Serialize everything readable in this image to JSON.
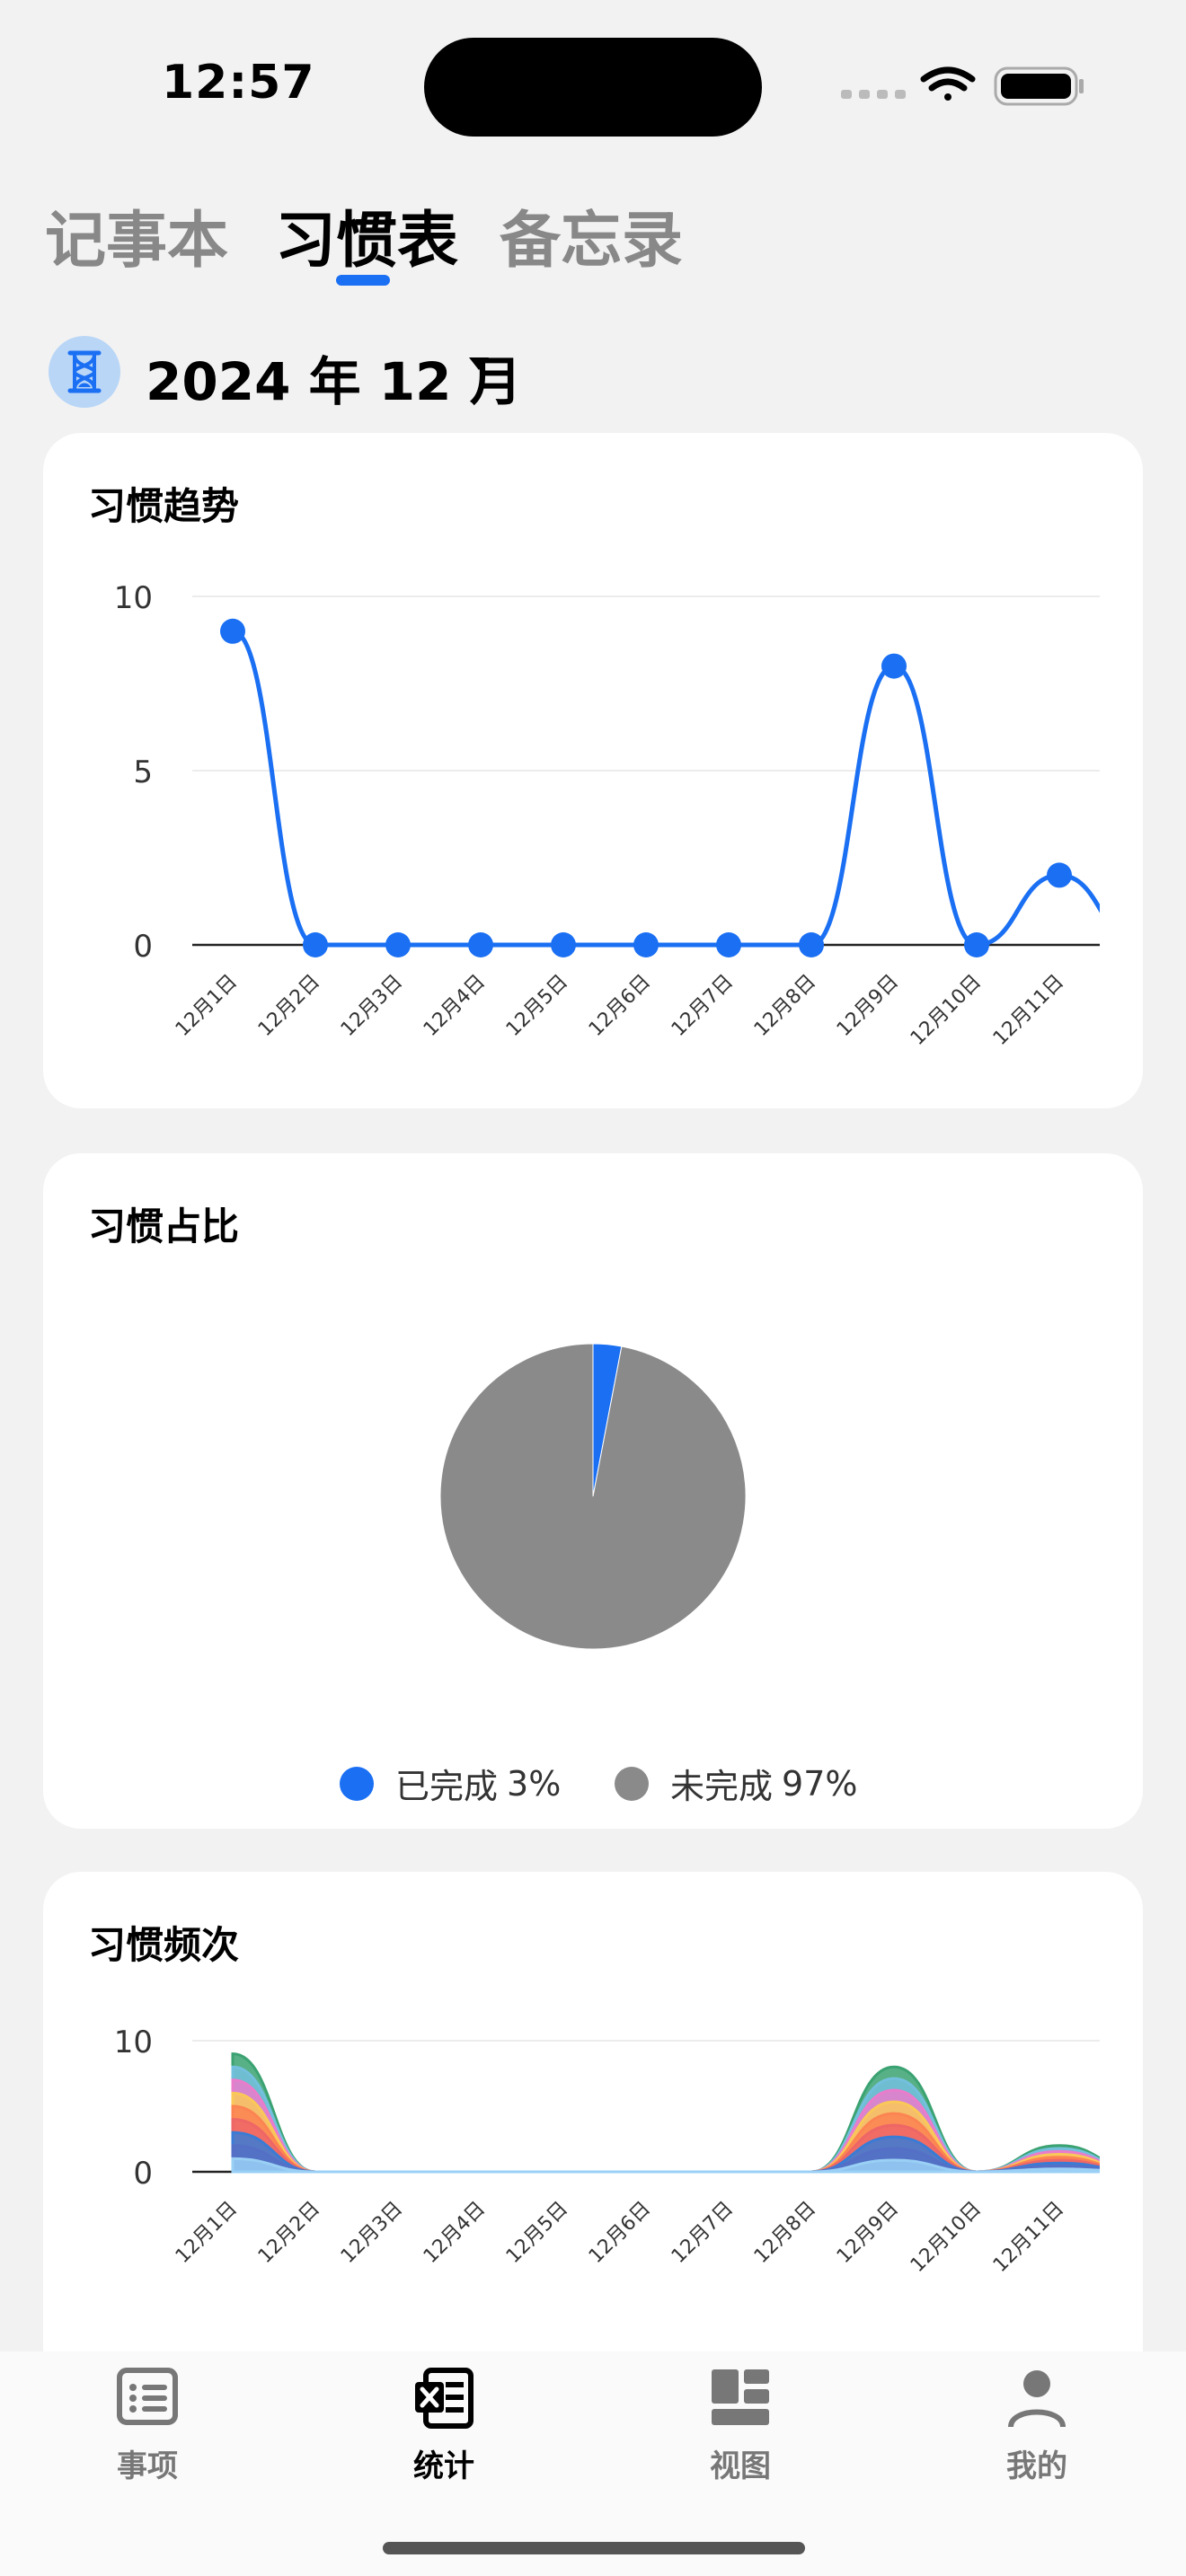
{
  "status_bar": {
    "time": "12:57"
  },
  "top_tabs": [
    {
      "label": "记事本",
      "active": false
    },
    {
      "label": "习惯表",
      "active": true
    },
    {
      "label": "备忘录",
      "active": false
    }
  ],
  "month_selector": {
    "label": "2024 年 12 月",
    "icon": "hourglass-icon"
  },
  "trend_card": {
    "title": "习惯趋势"
  },
  "ratio_card": {
    "title": "习惯占比"
  },
  "frequency_card": {
    "title": "习惯频次"
  },
  "bottom_nav": [
    {
      "label": "事项",
      "icon": "list-icon",
      "active": false
    },
    {
      "label": "统计",
      "icon": "spreadsheet-icon",
      "active": true
    },
    {
      "label": "视图",
      "icon": "dashboard-icon",
      "active": false
    },
    {
      "label": "我的",
      "icon": "profile-icon",
      "active": false
    }
  ],
  "colors": {
    "accent": "#1a6ff3",
    "incomplete": "#8a8a8a"
  },
  "chart_data": [
    {
      "type": "line",
      "title": "习惯趋势",
      "categories": [
        "12月1日",
        "12月2日",
        "12月3日",
        "12月4日",
        "12月5日",
        "12月6日",
        "12月7日",
        "12月8日",
        "12月9日",
        "12月10日",
        "12月11日"
      ],
      "values": [
        9,
        0,
        0,
        0,
        0,
        0,
        0,
        0,
        8,
        0,
        2
      ],
      "ylim": [
        0,
        10
      ],
      "yticks": [
        0,
        5,
        10
      ],
      "smooth": true,
      "grid": true
    },
    {
      "type": "pie",
      "title": "习惯占比",
      "slices": [
        {
          "label": "已完成",
          "value": 3,
          "display": "3%",
          "color": "#1a6ff3"
        },
        {
          "label": "未完成",
          "value": 97,
          "display": "97%",
          "color": "#8a8a8a"
        }
      ],
      "legend": "bottom"
    },
    {
      "type": "area",
      "title": "习惯频次",
      "stacked": true,
      "categories": [
        "12月1日",
        "12月2日",
        "12月3日",
        "12月4日",
        "12月5日",
        "12月6日",
        "12月7日",
        "12月8日",
        "12月9日",
        "12月10日",
        "12月11日"
      ],
      "totals": [
        9,
        0,
        0,
        0,
        0,
        0,
        0,
        0,
        8,
        0,
        2
      ],
      "layer_count": 9,
      "layer_colors": [
        "#9ad0f5",
        "#5470c6",
        "#3a7bd5",
        "#ee6666",
        "#fc8452",
        "#fac858",
        "#ea7ccc",
        "#73c0de",
        "#3ba272"
      ],
      "ylim": [
        0,
        10
      ],
      "yticks": [
        0,
        10
      ]
    }
  ]
}
